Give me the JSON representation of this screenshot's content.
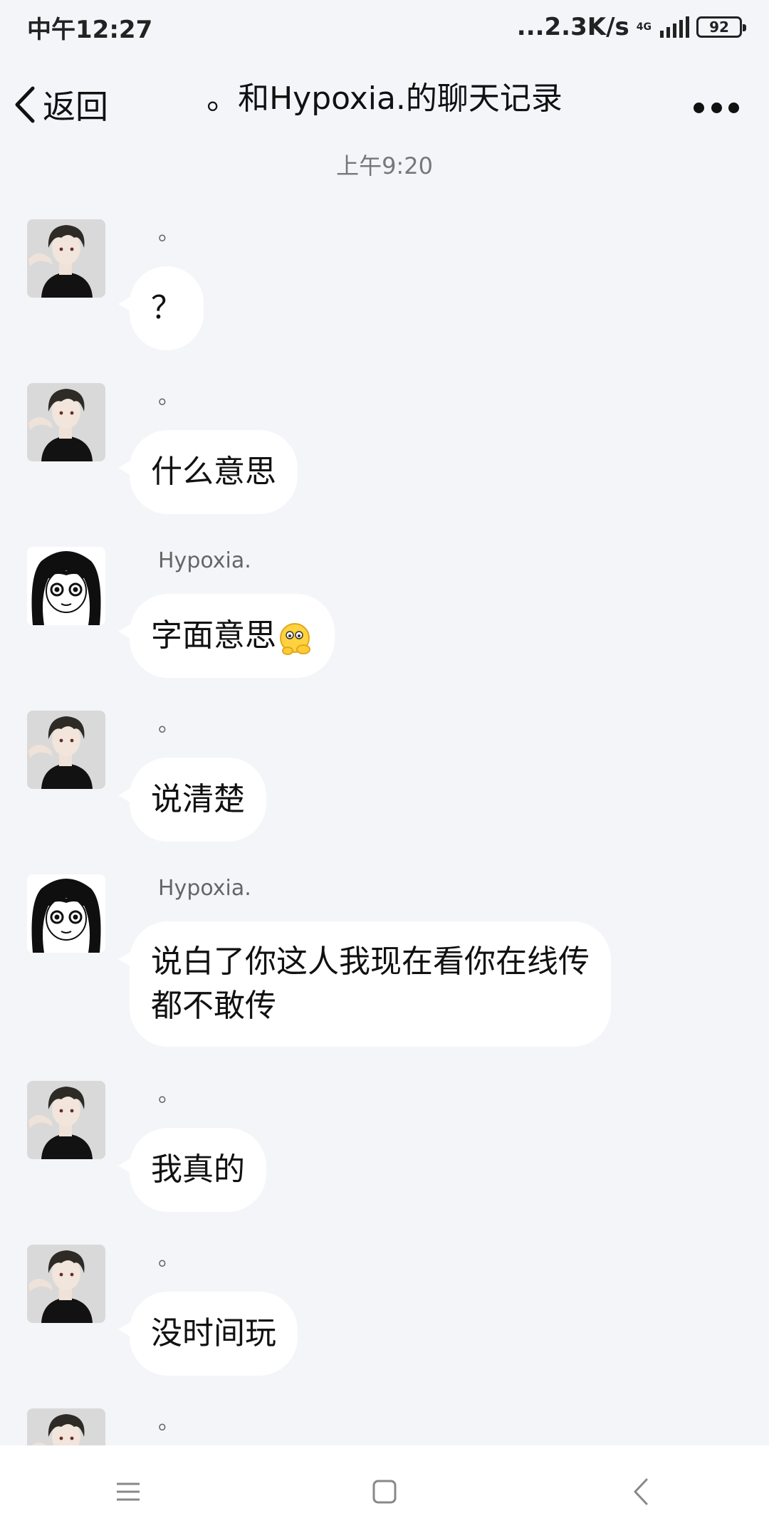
{
  "status_bar": {
    "time": "中午12:27",
    "network_speed": "...2.3K/s",
    "network_type": "4G",
    "battery": "92"
  },
  "header": {
    "back_label": "返回",
    "title": "。和Hypoxia.的聊天记录"
  },
  "timestamp": "上午9:20",
  "messages": [
    {
      "sender": "。",
      "text": "？",
      "avatar": "boy"
    },
    {
      "sender": "。",
      "text": "什么意思",
      "avatar": "boy"
    },
    {
      "sender": "Hypoxia.",
      "text": "字面意思",
      "avatar": "girl",
      "emoji": "peeking-face-emoji"
    },
    {
      "sender": "。",
      "text": "说清楚",
      "avatar": "boy"
    },
    {
      "sender": "Hypoxia.",
      "text_line1": "说白了你这人我现在看你在线传",
      "text_line2": "都不敢传",
      "avatar": "girl"
    },
    {
      "sender": "。",
      "text": "我真的",
      "avatar": "boy"
    },
    {
      "sender": "。",
      "text": "没时间玩",
      "avatar": "boy"
    },
    {
      "sender": "。",
      "avatar": "boy"
    }
  ],
  "nav_bar": {
    "icons": [
      "menu-icon",
      "home-square-icon",
      "back-chevron-icon"
    ]
  },
  "colors": {
    "background": "#f4f5f9",
    "bubble": "#ffffff"
  }
}
